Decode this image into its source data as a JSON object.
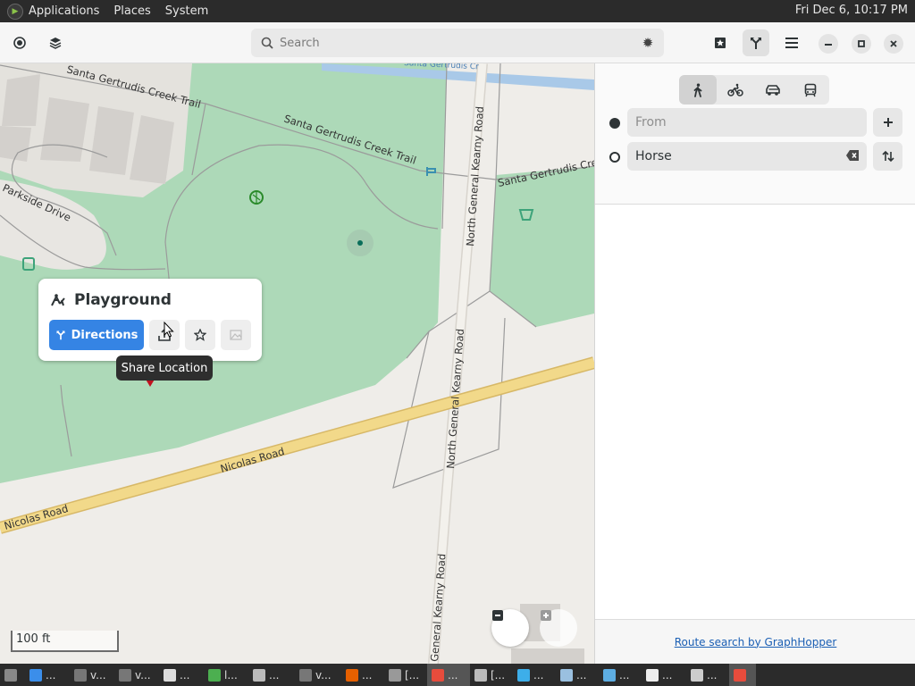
{
  "system_bar": {
    "menus": [
      "Applications",
      "Places",
      "System"
    ],
    "clock": "Fri Dec  6, 10:17 PM"
  },
  "header": {
    "search_placeholder": "Search",
    "icons": [
      "location-icon",
      "layers-icon",
      "search-icon",
      "gear-icon",
      "favorites-icon",
      "directions-icon",
      "menu-icon",
      "minimize-icon",
      "maximize-icon",
      "close-icon"
    ]
  },
  "map": {
    "labels": {
      "trail_1": "Santa Gertrudis Creek Trail",
      "trail_2": "Santa Gertrudis Creek Trail",
      "trail_3": "Santa Gertrudis Cree",
      "parkside": "Parkside Drive",
      "kearny_1": "North General Kearny Road",
      "kearny_2": "North General Kearny Road",
      "kearny_3": "General Kearny Road",
      "nicolas_1": "Nicolas Road",
      "nicolas_2": "Nicolas Road",
      "creek": "Santa Gertrudis Cr"
    },
    "scale_label": "100 ft",
    "colors": {
      "park": "#a9d9b9",
      "road_major": "#f2d98a",
      "land": "#efede9",
      "water": "#a9c9e8"
    }
  },
  "popover": {
    "title": "Playground",
    "directions_label": "Directions",
    "tooltip": "Share Location"
  },
  "sidebar": {
    "modes": [
      "walk-icon",
      "bike-icon",
      "car-icon",
      "transit-icon"
    ],
    "active_mode": "walk",
    "from_placeholder": "From",
    "to_value": "Horse",
    "footer_link": "Route search by GraphHopper"
  },
  "taskbar": {
    "items": [
      {
        "label": "",
        "icon": "show-desktop-icon",
        "color": "#888888"
      },
      {
        "label": "...",
        "icon": "vscode-icon",
        "color": "#3b8eea"
      },
      {
        "label": "v...",
        "icon": "terminal-icon",
        "color": "#777777"
      },
      {
        "label": "v...",
        "icon": "terminal-icon",
        "color": "#777777"
      },
      {
        "label": "...",
        "icon": "window-icon",
        "color": "#dddddd"
      },
      {
        "label": "l...",
        "icon": "app-icon",
        "color": "#4caf50"
      },
      {
        "label": "...",
        "icon": "folder-icon",
        "color": "#bbbbbb"
      },
      {
        "label": "v...",
        "icon": "terminal-icon",
        "color": "#777777"
      },
      {
        "label": "...",
        "icon": "firefox-icon",
        "color": "#e66000"
      },
      {
        "label": "[...",
        "icon": "camera-icon",
        "color": "#999999"
      },
      {
        "label": "...",
        "icon": "maps-icon",
        "color": "#e74c3c"
      },
      {
        "label": "[...",
        "icon": "screenshot-icon",
        "color": "#bbbbbb"
      },
      {
        "label": "...",
        "icon": "globe-icon",
        "color": "#3daee9"
      },
      {
        "label": "...",
        "icon": "settings-icon",
        "color": "#9ac0e0"
      },
      {
        "label": "...",
        "icon": "weather-icon",
        "color": "#5dade2"
      },
      {
        "label": "...",
        "icon": "home-icon",
        "color": "#eeeeee"
      },
      {
        "label": "...",
        "icon": "disk-icon",
        "color": "#cccccc"
      },
      {
        "label": "",
        "icon": "maps-active-icon",
        "color": "#e74c3c"
      }
    ]
  }
}
